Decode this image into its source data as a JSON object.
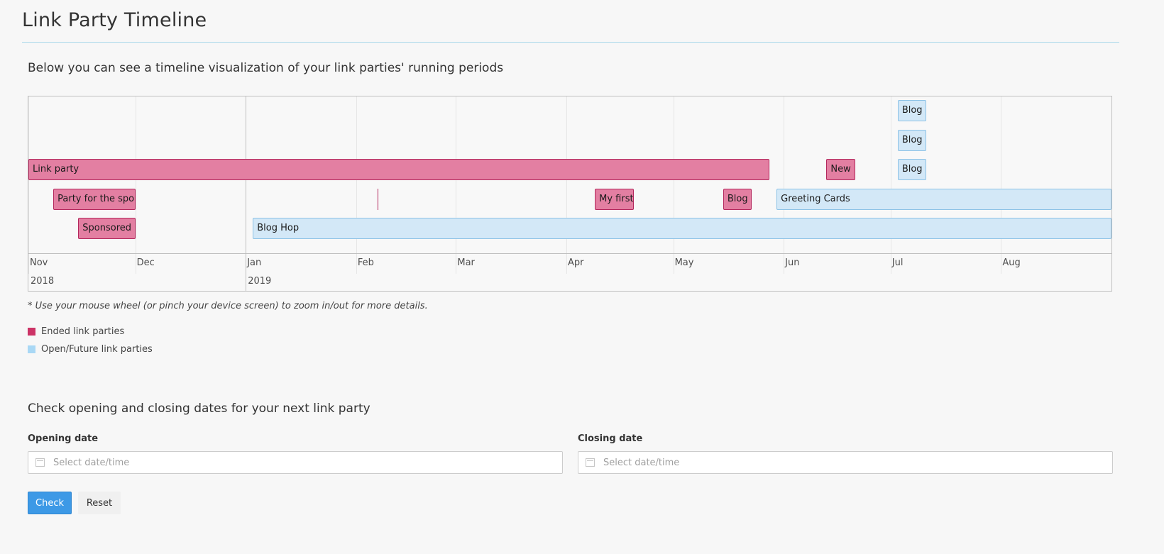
{
  "page": {
    "title": "Link Party Timeline",
    "intro": "Below you can see a timeline visualization of your link parties' running periods",
    "zoom_note": "* Use your mouse wheel (or pinch your device screen) to zoom in/out for more details."
  },
  "timeline": {
    "range": [
      "2018-11-01",
      "2019-08-31"
    ],
    "months": [
      {
        "label": "Nov",
        "date": "2018-11-01"
      },
      {
        "label": "Dec",
        "date": "2018-12-01"
      },
      {
        "label": "Jan",
        "date": "2019-01-01"
      },
      {
        "label": "Feb",
        "date": "2019-02-01"
      },
      {
        "label": "Mar",
        "date": "2019-03-01"
      },
      {
        "label": "Apr",
        "date": "2019-04-01"
      },
      {
        "label": "May",
        "date": "2019-05-01"
      },
      {
        "label": "Jun",
        "date": "2019-06-01"
      },
      {
        "label": "Jul",
        "date": "2019-07-01"
      },
      {
        "label": "Aug",
        "date": "2019-08-01"
      }
    ],
    "years": [
      {
        "label": "2018",
        "date": "2018-11-01"
      },
      {
        "label": "2019",
        "date": "2019-01-01"
      }
    ],
    "items": [
      {
        "label": "Blog",
        "status": "open",
        "row": 0,
        "start": "2019-07-03",
        "end": "2019-07-10"
      },
      {
        "label": "Blog",
        "status": "open",
        "row": 1,
        "start": "2019-07-03",
        "end": "2019-07-10"
      },
      {
        "label": "Link party",
        "status": "ended",
        "row": 2,
        "start": "2018-11-01",
        "end": "2019-05-27"
      },
      {
        "label": "New",
        "status": "ended",
        "row": 2,
        "start": "2019-06-13",
        "end": "2019-06-20"
      },
      {
        "label": "Blog",
        "status": "open",
        "row": 2,
        "start": "2019-07-03",
        "end": "2019-07-10"
      },
      {
        "label": "Party for the sponsored posts",
        "status": "ended",
        "row": 3,
        "start": "2018-11-08",
        "end": "2018-11-30"
      },
      {
        "label": "",
        "status": "ended",
        "row": 3,
        "start": "2019-02-07",
        "end": "2019-02-07"
      },
      {
        "label": "My first link party",
        "status": "ended",
        "row": 3,
        "start": "2019-04-09",
        "end": "2019-04-19"
      },
      {
        "label": "Blog",
        "status": "ended",
        "row": 3,
        "start": "2019-05-15",
        "end": "2019-05-22"
      },
      {
        "label": "Greeting Cards",
        "status": "open",
        "row": 3,
        "start": "2019-05-30",
        "end": "2019-08-31"
      },
      {
        "label": "Sponsored",
        "status": "ended",
        "row": 4,
        "start": "2018-11-15",
        "end": "2018-11-30"
      },
      {
        "label": "Blog Hop",
        "status": "open",
        "row": 4,
        "start": "2019-01-03",
        "end": "2019-08-31"
      }
    ]
  },
  "legend": {
    "ended": {
      "label": "Ended link parties",
      "color": "#cc3366"
    },
    "open": {
      "label": "Open/Future link parties",
      "color": "#a9d8f5"
    }
  },
  "check": {
    "title": "Check opening and closing dates for your next link party",
    "opening_label": "Opening date",
    "closing_label": "Closing date",
    "placeholder": "Select date/time",
    "icon": "calendar-icon",
    "check_button": "Check",
    "reset_button": "Reset"
  }
}
